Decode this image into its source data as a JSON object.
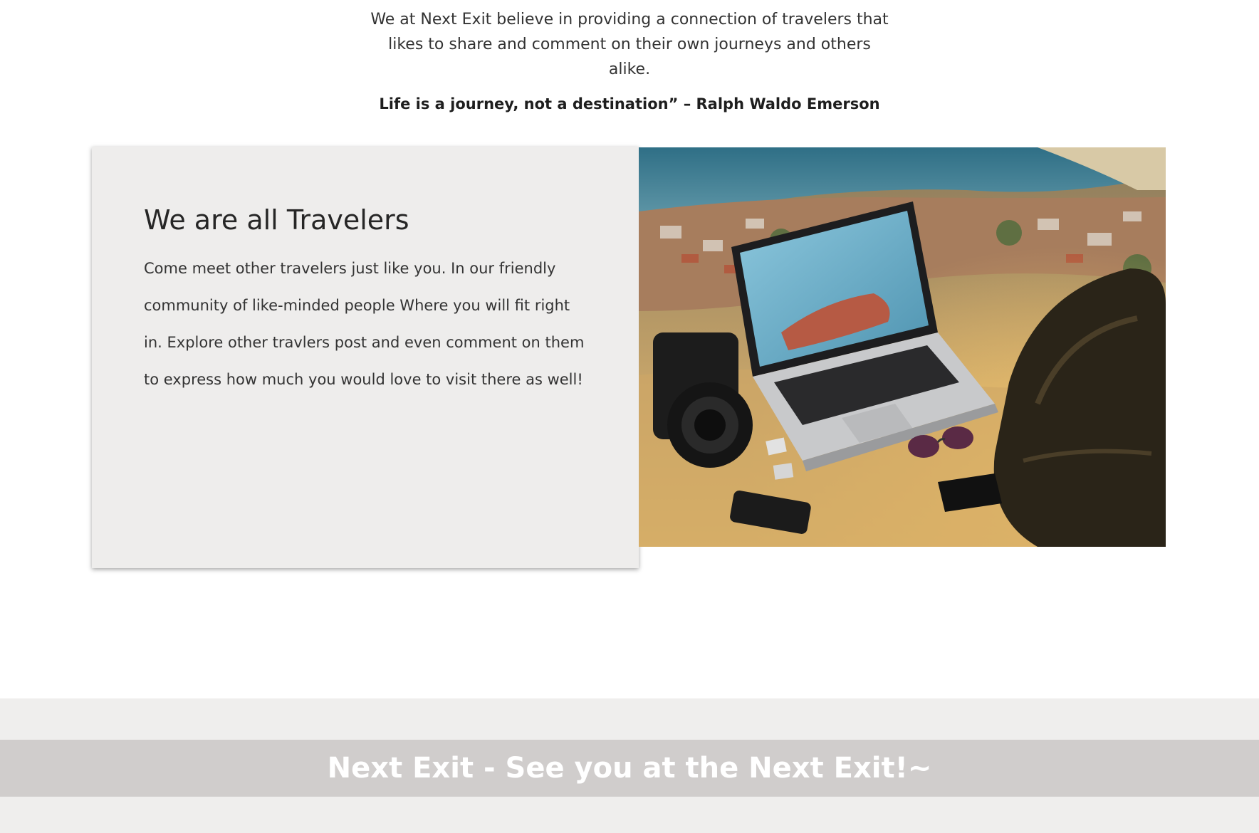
{
  "intro": {
    "line1": "We at Next Exit believe in providing a connection of travelers that",
    "line2": "likes to share and comment on their own journeys and others alike.",
    "quote": "Life is a journey, not a destination” – Ralph Waldo Emerson"
  },
  "card": {
    "title": "We are all Travelers",
    "body": "Come meet other travelers just like you. In our friendly community of like-minded people Where you will fit right in. Explore other travlers post and even comment on them to express how much you would love to visit there as well!"
  },
  "photo": {
    "icons": [
      "laptop-icon",
      "camera-icon",
      "backpack-icon",
      "sunglasses-icon",
      "phone-icon"
    ]
  },
  "footer": {
    "text": "Next Exit - See you at the Next Exit!~"
  }
}
